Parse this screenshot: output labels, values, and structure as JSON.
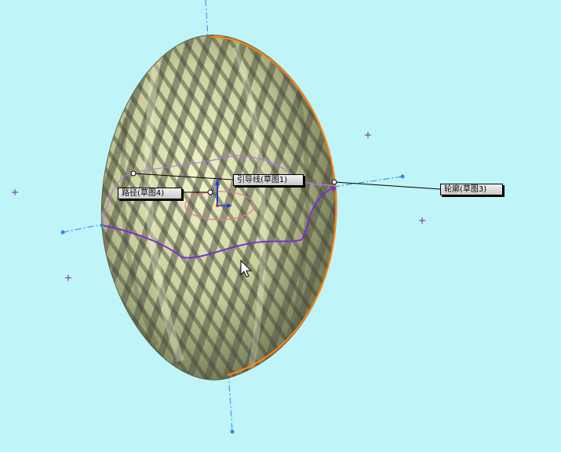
{
  "viewport": {
    "background": "#bff4f9",
    "callouts": {
      "guide_curve": "引导线(草图1)",
      "path": "路径(草图4)",
      "profile": "轮廓(草图3)"
    },
    "colors": {
      "profile_curve": "#ff7f11",
      "guide_curve": "#7a2fd0",
      "path_curve": "#e87aa0",
      "axis_line": "#2f88d9",
      "origin_marker": "#7a1fa8"
    },
    "icons": [
      "origin-plus-icon",
      "mouse-pointer-icon",
      "triad-axis-icon"
    ]
  }
}
